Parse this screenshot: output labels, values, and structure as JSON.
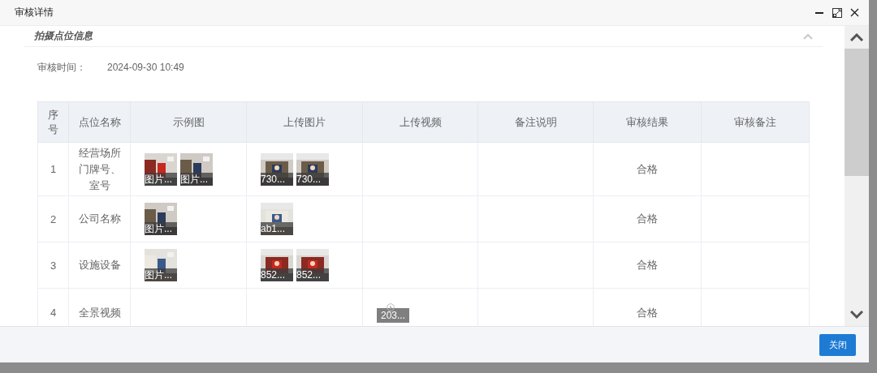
{
  "window": {
    "title": "审核详情"
  },
  "section": {
    "title": "拍摄点位信息",
    "expanded": true
  },
  "audit_time": {
    "label": "审核时间：",
    "value": "2024-09-30 10:49"
  },
  "table": {
    "columns": [
      "序号",
      "点位名称",
      "示例图",
      "上传图片",
      "上传视频",
      "备注说明",
      "审核结果",
      "审核备注"
    ],
    "rows": [
      {
        "seq": "1",
        "name": "经营场所门牌号、室号",
        "sample_images": [
          {
            "caption": "图片..."
          },
          {
            "caption": "图片..."
          }
        ],
        "uploaded_images": [
          {
            "caption": "730..."
          },
          {
            "caption": "730..."
          }
        ],
        "uploaded_videos": [],
        "result": "合格"
      },
      {
        "seq": "2",
        "name": "公司名称",
        "sample_images": [
          {
            "caption": "图片..."
          }
        ],
        "uploaded_images": [
          {
            "caption": "ab1..."
          }
        ],
        "uploaded_videos": [],
        "result": "合格"
      },
      {
        "seq": "3",
        "name": "设施设备",
        "sample_images": [
          {
            "caption": "图片..."
          }
        ],
        "uploaded_images": [
          {
            "caption": "852..."
          },
          {
            "caption": "852..."
          }
        ],
        "uploaded_videos": [],
        "result": "合格"
      },
      {
        "seq": "4",
        "name": "全景视频",
        "sample_images": [],
        "uploaded_images": [],
        "uploaded_videos": [
          {
            "caption": "203..."
          }
        ],
        "result": "合格"
      }
    ]
  },
  "buttons": [
    "关闭"
  ]
}
